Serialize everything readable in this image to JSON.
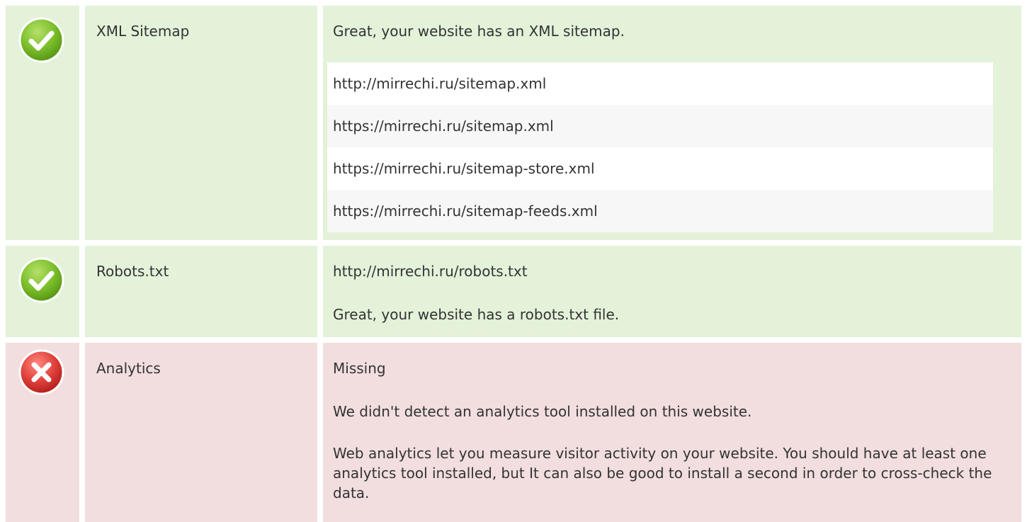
{
  "colors": {
    "pass_bg": "#e3f2d9",
    "fail_bg": "#f2dede",
    "pass_icon": "#7cbf2a",
    "fail_icon": "#e0413c"
  },
  "checks": [
    {
      "status": "pass",
      "status_icon": "check-circle-icon",
      "label": "XML Sitemap",
      "message": "Great, your website has an XML sitemap.",
      "urls": [
        "http://mirrechi.ru/sitemap.xml",
        "https://mirrechi.ru/sitemap.xml",
        "https://mirrechi.ru/sitemap-store.xml",
        "https://mirrechi.ru/sitemap-feeds.xml"
      ]
    },
    {
      "status": "pass",
      "status_icon": "check-circle-icon",
      "label": "Robots.txt",
      "url": "http://mirrechi.ru/robots.txt",
      "message": "Great, your website has a robots.txt file."
    },
    {
      "status": "fail",
      "status_icon": "error-circle-icon",
      "label": "Analytics",
      "value": "Missing",
      "message": "We didn't detect an analytics tool installed on this website.",
      "advice": "Web analytics let you measure visitor activity on your website. You should have at least one analytics tool installed, but It can also be good to install a second in order to cross-check the data."
    }
  ]
}
